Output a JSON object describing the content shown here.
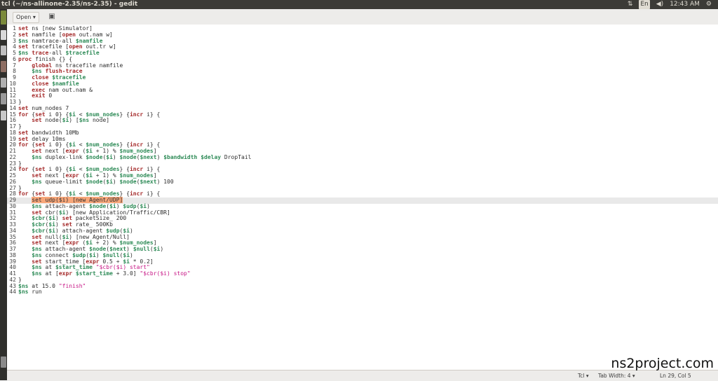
{
  "window": {
    "title": "tcl (~/ns-allinone-2.35/ns-2.35) - gedit"
  },
  "tray": {
    "keyboard": "En",
    "volume_icon": "speaker-icon",
    "sort_icon": "network-icon",
    "clock": "12:43 AM",
    "gear_icon": "gear-icon"
  },
  "toolbar": {
    "open_label": "Open ▾",
    "save_icon": "save-icon"
  },
  "editor": {
    "current_line": 29,
    "lines": [
      "[k]set[/] ns [new Simulator]",
      "[k]set[/] namfile [[k]open[/] out.nam w]",
      "[v]$ns[/] namtrace-all [v]$namfile[/]",
      "[k]set[/] tracefile [[k]open[/] out.tr w]",
      "[v]$ns[/] [k]trace[/]-all [v]$tracefile[/]",
      "[k]proc[/] finish {} {",
      "    [k]global[/] ns tracefile namfile",
      "    [v]$ns[/] [k]flush-trace[/]",
      "    [k]close[/] [v]$tracefile[/]",
      "    [k]close[/] [v]$namfile[/]",
      "    [k]exec[/] nam out.nam &",
      "    [k]exit[/] 0",
      "}",
      "[k]set[/] num_nodes 7",
      "[k]for[/] {[k]set[/] i 0} {[v]$i[/] < [v]$num_nodes[/]} {[k]incr[/] i} {",
      "    [k]set[/] node([v]$i[/]) [[v]$ns[/] node]",
      "}",
      "[k]set[/] bandwidth 10Mb",
      "[k]set[/] delay 10ms",
      "[k]for[/] {[k]set[/] i 0} {[v]$i[/] < [v]$num_nodes[/]} {[k]incr[/] i} {",
      "    [k]set[/] next [[k]expr[/] ([v]$i[/] + 1) % [v]$num_nodes[/]]",
      "    [v]$ns[/] duplex-link [v]$node[/]([v]$i[/]) [v]$node[/]([v]$next[/]) [v]$bandwidth[/] [v]$delay[/] DropTail",
      "}",
      "[k]for[/] {[k]set[/] i 0} {[v]$i[/] < [v]$num_nodes[/]} {[k]incr[/] i} {",
      "    [k]set[/] next [[k]expr[/] ([v]$i[/] + 1) % [v]$num_nodes[/]]",
      "    [v]$ns[/] queue-limit [v]$node[/]([v]$i[/]) [v]$node[/]([v]$next[/]) 100",
      "}",
      "[k]for[/] {[k]set[/] i 0} {[v]$i[/] < [v]$num_nodes[/]} {[k]incr[/] i} {",
      "    [x]set udp($i) [new Agent/UDP][/]",
      "    [v]$ns[/] attach-agent [v]$node[/]([v]$i[/]) [v]$udp[/]([v]$i[/])",
      "    [k]set[/] cbr([v]$i[/]) [new Application/Traffic/CBR]",
      "    [v]$cbr[/]([v]$i[/]) [k]set[/] packetSize_ 200",
      "    [v]$cbr[/]([v]$i[/]) [k]set[/] rate_ 500Kb",
      "    [v]$cbr[/]([v]$i[/]) attach-agent [v]$udp[/]([v]$i[/])",
      "    [k]set[/] null([v]$i[/]) [new Agent/Null]",
      "    [k]set[/] next [[k]expr[/] ([v]$i[/] + 2) % [v]$num_nodes[/]]",
      "    [v]$ns[/] attach-agent [v]$node[/]([v]$next[/]) [v]$null[/]([v]$i[/])",
      "    [v]$ns[/] connect [v]$udp[/]([v]$i[/]) [v]$null[/]([v]$i[/])",
      "    [k]set[/] start_time [[k]expr[/] 0.5 + [v]$i[/] * 0.2]",
      "    [v]$ns[/] at [v]$start_time[/] [s]\"$cbr($i) start\"[/]",
      "    [v]$ns[/] at [[k]expr[/] [v]$start_time[/] + 3.0] [s]\"$cbr($i) stop\"[/]",
      "}",
      "[v]$ns[/] at 15.0 [s]\"finish\"[/]",
      "[v]$ns[/] run"
    ]
  },
  "statusbar": {
    "language": "Tcl ▾",
    "tab_width": "Tab Width: 4 ▾",
    "position": "Ln 29, Col 5"
  },
  "watermark": "ns2project.com"
}
